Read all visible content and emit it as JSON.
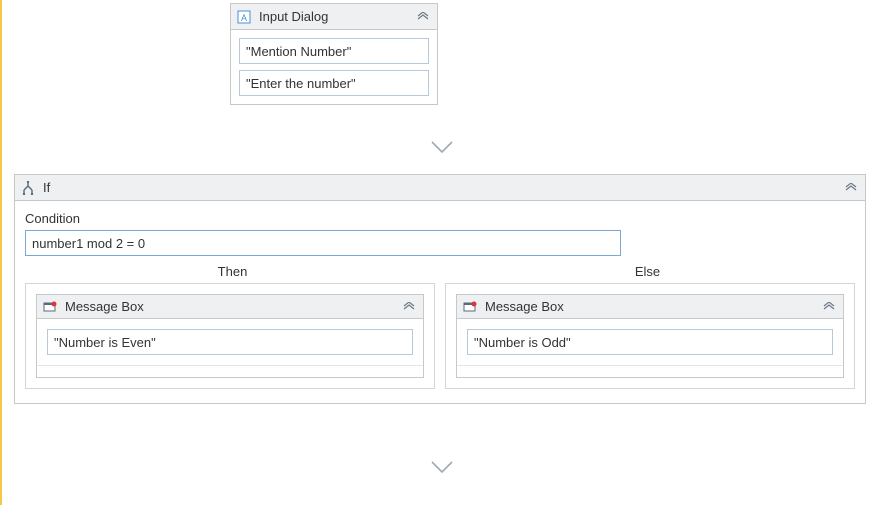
{
  "inputDialog": {
    "title": "Input Dialog",
    "titleField": "\"Mention Number\"",
    "labelField": "\"Enter the number\""
  },
  "ifActivity": {
    "title": "If",
    "conditionLabel": "Condition",
    "conditionValue": "number1 mod 2 = 0",
    "thenLabel": "Then",
    "elseLabel": "Else",
    "thenBranch": {
      "title": "Message Box",
      "value": "\"Number is Even\""
    },
    "elseBranch": {
      "title": "Message Box",
      "value": "\"Number is Odd\""
    }
  }
}
